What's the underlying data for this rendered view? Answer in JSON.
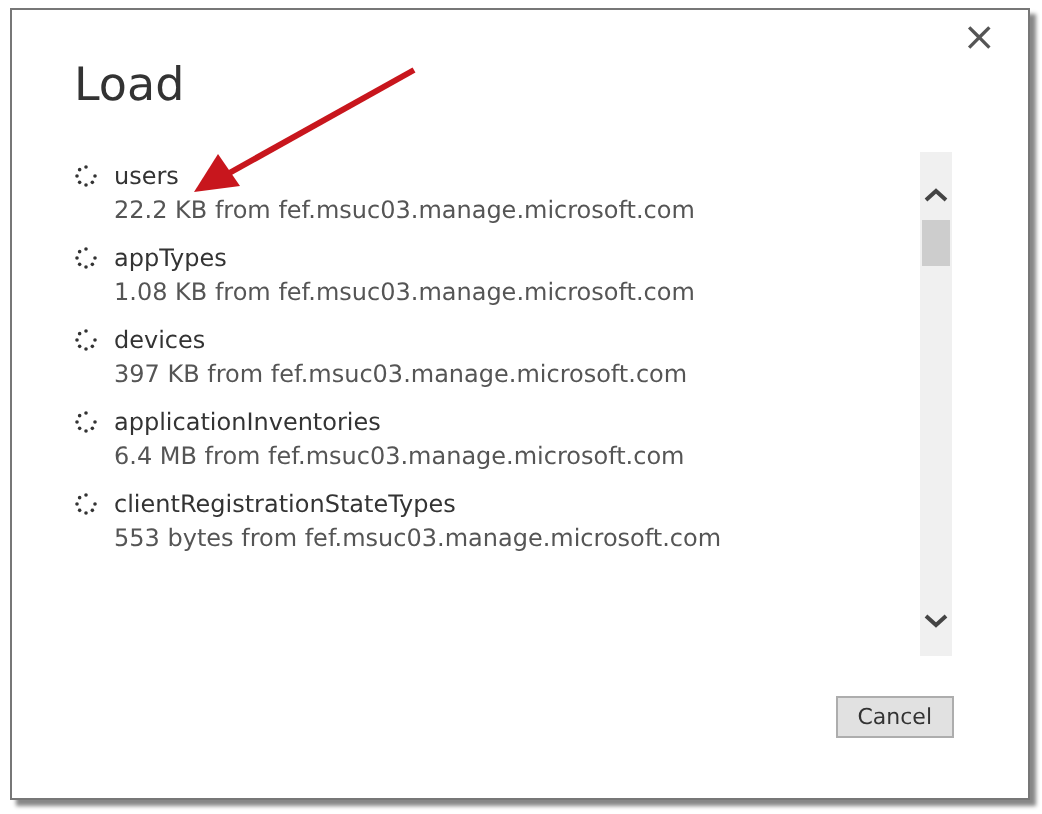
{
  "window": {
    "title": "Load",
    "close": "×"
  },
  "items": [
    {
      "name": "users",
      "detail": "22.2 KB from fef.msuc03.manage.microsoft.com"
    },
    {
      "name": "appTypes",
      "detail": "1.08 KB from fef.msuc03.manage.microsoft.com"
    },
    {
      "name": "devices",
      "detail": "397 KB from fef.msuc03.manage.microsoft.com"
    },
    {
      "name": "applicationInventories",
      "detail": "6.4 MB from fef.msuc03.manage.microsoft.com"
    },
    {
      "name": "clientRegistrationStateTypes",
      "detail": "553 bytes from fef.msuc03.manage.microsoft.com"
    }
  ],
  "buttons": [
    "Cancel"
  ]
}
